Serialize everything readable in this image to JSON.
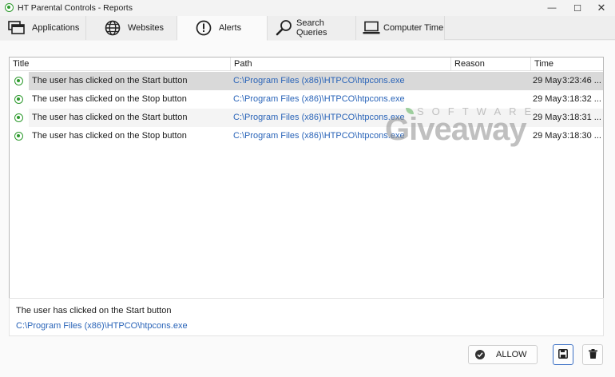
{
  "window": {
    "title": "HT Parental Controls - Reports",
    "min_glyph": "—",
    "max_glyph": "☐",
    "close_glyph": "✕"
  },
  "tabs": [
    {
      "label": "Applications",
      "icon": "applications-icon"
    },
    {
      "label": "Websites",
      "icon": "globe-icon"
    },
    {
      "label": "Alerts",
      "icon": "alert-icon",
      "active": true
    },
    {
      "label": "Search Queries",
      "icon": "search-icon"
    },
    {
      "label": "Computer Time",
      "icon": "laptop-icon"
    }
  ],
  "grid": {
    "columns": [
      "Title",
      "Path",
      "Reason",
      "Time"
    ],
    "rows": [
      {
        "title": "The user has clicked on the Start button",
        "path": "C:\\Program Files (x86)\\HTPCO\\htpcons.exe",
        "reason": "",
        "date": "29 May",
        "time": "3:23:46 ..."
      },
      {
        "title": "The user has clicked on the Stop button",
        "path": "C:\\Program Files (x86)\\HTPCO\\htpcons.exe",
        "reason": "",
        "date": "29 May",
        "time": "3:18:32 ..."
      },
      {
        "title": "The user has clicked on the Start button",
        "path": "C:\\Program Files (x86)\\HTPCO\\htpcons.exe",
        "reason": "",
        "date": "29 May",
        "time": "3:18:31 ..."
      },
      {
        "title": "The user has clicked on the Stop button",
        "path": "C:\\Program Files (x86)\\HTPCO\\htpcons.exe",
        "reason": "",
        "date": "29 May",
        "time": "3:18:30 ..."
      }
    ]
  },
  "watermark": {
    "top": "SOFTWARE",
    "main": "Giveaway"
  },
  "details": {
    "title": "The user has clicked on the Start button",
    "path": "C:\\Program Files (x86)\\HTPCO\\htpcons.exe"
  },
  "actions": {
    "allow_label": "ALLOW"
  },
  "colors": {
    "accent_green": "#2e9a2e",
    "link_blue": "#2a64b8",
    "selected_row": "#d9d9d9"
  }
}
